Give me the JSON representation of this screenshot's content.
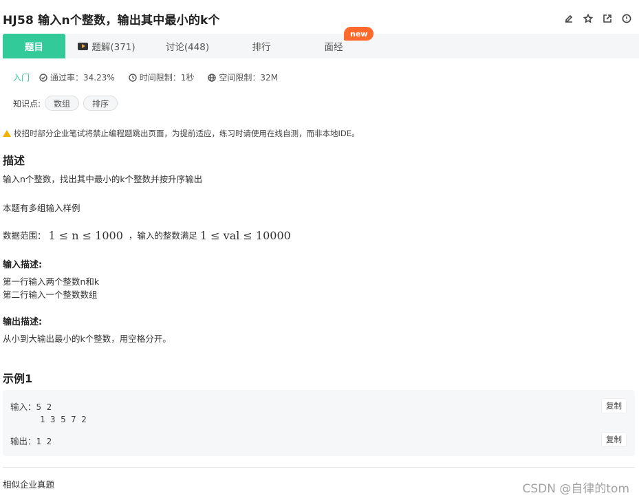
{
  "title": "HJ58  输入n个整数，输出其中最小的k个",
  "title_actions": [
    {
      "icon": "edit-icon"
    },
    {
      "icon": "star-icon"
    },
    {
      "icon": "external-link-icon"
    },
    {
      "icon": "info-icon"
    }
  ],
  "tabs": {
    "problem": "题目",
    "solutions": "题解(371)",
    "discuss": "讨论(448)",
    "rank": "排行",
    "interview": "面经",
    "new_badge": "new"
  },
  "meta": {
    "level": "入门",
    "pass_rate": "通过率：34.23%",
    "time_limit": "时间限制：1秒",
    "space_limit": "空间限制：32M"
  },
  "knowledge": {
    "label": "知识点:",
    "tags": [
      "数组",
      "排序"
    ]
  },
  "warning": "校招时部分企业笔试将禁止编程题跳出页面，为提前适应，练习时请使用在线自测，而非本地IDE。",
  "description": {
    "heading": "描述",
    "line1": "输入n个整数，找出其中最小的k个整数并按升序输出",
    "line2": "本题有多组输入样例",
    "range_label": "数据范围：",
    "range_math1": "1 ≤ n ≤ 1000",
    "range_mid": "，输入的整数满足",
    "range_math2": "1 ≤ val ≤ 10000"
  },
  "input_desc": {
    "heading": "输入描述:",
    "line1": "第一行输入两个整数n和k",
    "line2": "第二行输入一个整数数组"
  },
  "output_desc": {
    "heading": "输出描述:",
    "line1": "从小到大输出最小的k个整数，用空格分开。"
  },
  "example": {
    "heading": "示例1",
    "input_label": "输入：",
    "input_line1": "5 2",
    "input_line2": "1 3 5 7 2",
    "output_label": "输出：",
    "output_line1": "1 2",
    "copy_label": "复制"
  },
  "similar": "相似企业真题",
  "watermark": "CSDN @自律的tom"
}
